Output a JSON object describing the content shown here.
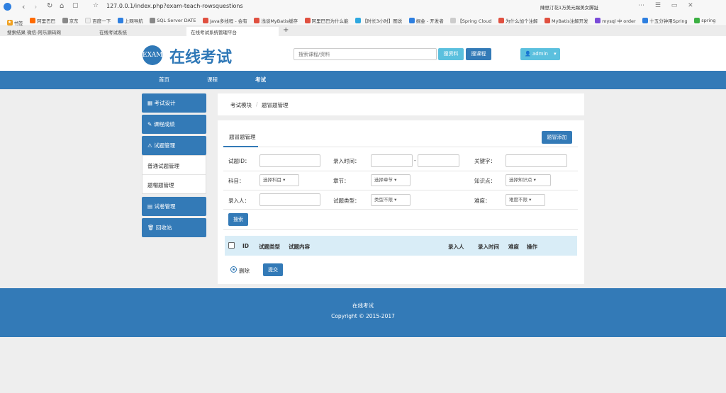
{
  "browser": {
    "url": "127.0.0.1/index.php?exam-teach-rowsquestions",
    "right_promo": "陳思汀花1万美元踢美女脚趾",
    "bookmarks": [
      "书签",
      "阿里巴巴",
      "京东",
      "百度一下",
      "上网导航",
      "SQL Server DATE",
      "Java多线程 - 会有",
      "浅谈MyBatis缓存",
      "阿里巴巴为什么能",
      "【时长3小时】图说",
      "掘金 - 开发者",
      "【Spring Cloud",
      "为什么加个注解",
      "MyBatis注解开发",
      "mysql 中 order",
      "十五分钟用Spring",
      "spring"
    ],
    "tabs": [
      "搜索结果 微信-阿乐源码网",
      "在线考试系统",
      "在线考试系统管理平台"
    ],
    "new_tab": "+"
  },
  "header": {
    "logo_mark": "EXAM",
    "logo_text": "在线考试",
    "search_placeholder": "搜索课程/资料",
    "search_material": "搜资料",
    "search_course": "搜课程",
    "user": "admin"
  },
  "nav": [
    "首页",
    "课程",
    "考试"
  ],
  "sidebar": {
    "items": [
      "考试设计",
      "课程成绩",
      "试题管理",
      "试卷管理",
      "回收站"
    ],
    "subitems": [
      "普通试题管理",
      "题帽题管理"
    ]
  },
  "breadcrumb": {
    "parent": "考试模块",
    "sep": "/",
    "current": "题冒题管理"
  },
  "panel": {
    "title": "题冒题管理",
    "add_button": "题冒添加",
    "form": {
      "question_id": "试题ID：",
      "entry_time": "录入时间：",
      "range_sep": "-",
      "keyword": "关键字：",
      "subject": "科目：",
      "subject_select": "选择科目",
      "chapter": "章节：",
      "chapter_select": "选择章节",
      "knowledge": "知识点：",
      "knowledge_select": "选择知识点",
      "author": "录入人：",
      "qtype": "试题类型：",
      "qtype_select": "类型不限",
      "difficulty": "难度：",
      "difficulty_select": "难度不限",
      "search_button": "搜索"
    },
    "table": {
      "columns": [
        "ID",
        "试题类型",
        "试题内容",
        "录入人",
        "录入时间",
        "难度",
        "操作"
      ]
    },
    "delete_label": "删除",
    "submit_button": "提交"
  },
  "footer": {
    "title": "在线考试",
    "copyright": "Copyright © 2015-2017"
  },
  "colors": {
    "primary": "#337ab7",
    "info": "#5bc0de",
    "table_head": "#d9edf7"
  }
}
